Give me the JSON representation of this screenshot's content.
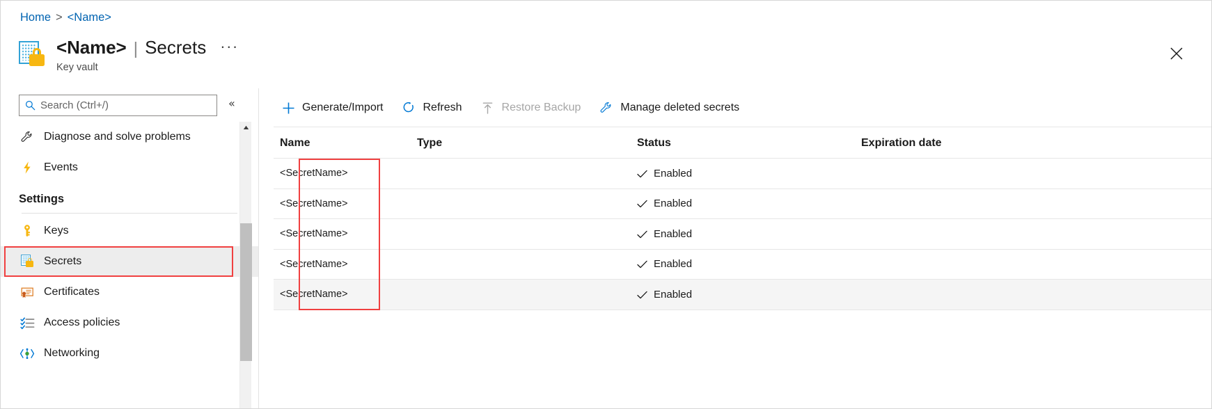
{
  "breadcrumb": {
    "home": "Home",
    "separator": ">",
    "current": "<Name>"
  },
  "header": {
    "resource_name": "<Name>",
    "pipe": "|",
    "page": "Secrets",
    "more_label": "···",
    "resource_type": "Key vault",
    "close_label": "Close"
  },
  "sidebar": {
    "search": {
      "placeholder": "Search (Ctrl+/)",
      "value": ""
    },
    "collapse_label": "«",
    "items": [
      {
        "label": "Diagnose and solve problems",
        "icon": "wrench-icon",
        "selected": false
      },
      {
        "label": "Events",
        "icon": "lightning-bolt-icon",
        "selected": false
      }
    ],
    "section_title": "Settings",
    "settings_items": [
      {
        "label": "Keys",
        "icon": "key-icon",
        "selected": false
      },
      {
        "label": "Secrets",
        "icon": "key-vault-secret-icon",
        "selected": true
      },
      {
        "label": "Certificates",
        "icon": "certificate-icon",
        "selected": false
      },
      {
        "label": "Access policies",
        "icon": "access-policies-icon",
        "selected": false
      },
      {
        "label": "Networking",
        "icon": "networking-icon",
        "selected": false
      }
    ]
  },
  "toolbar": {
    "buttons": [
      {
        "label": "Generate/Import",
        "icon": "plus-icon",
        "disabled": false
      },
      {
        "label": "Refresh",
        "icon": "refresh-icon",
        "disabled": false
      },
      {
        "label": "Restore Backup",
        "icon": "upload-arrow-icon",
        "disabled": true
      },
      {
        "label": "Manage deleted secrets",
        "icon": "wrench-icon",
        "disabled": false
      }
    ]
  },
  "table": {
    "columns": [
      "Name",
      "Type",
      "Status",
      "Expiration date"
    ],
    "rows": [
      {
        "name": "<SecretName>",
        "type": "",
        "status": "Enabled",
        "expiration": ""
      },
      {
        "name": "<SecretName>",
        "type": "",
        "status": "Enabled",
        "expiration": ""
      },
      {
        "name": "<SecretName>",
        "type": "",
        "status": "Enabled",
        "expiration": ""
      },
      {
        "name": "<SecretName>",
        "type": "",
        "status": "Enabled",
        "expiration": ""
      },
      {
        "name": "<SecretName>",
        "type": "",
        "status": "Enabled",
        "expiration": ""
      }
    ]
  },
  "colors": {
    "link": "#0063b1",
    "highlight_red": "#f04040",
    "accent_blue": "#0078d4",
    "lock_yellow": "#f7b711",
    "selected_row_bg": "#ededed"
  }
}
